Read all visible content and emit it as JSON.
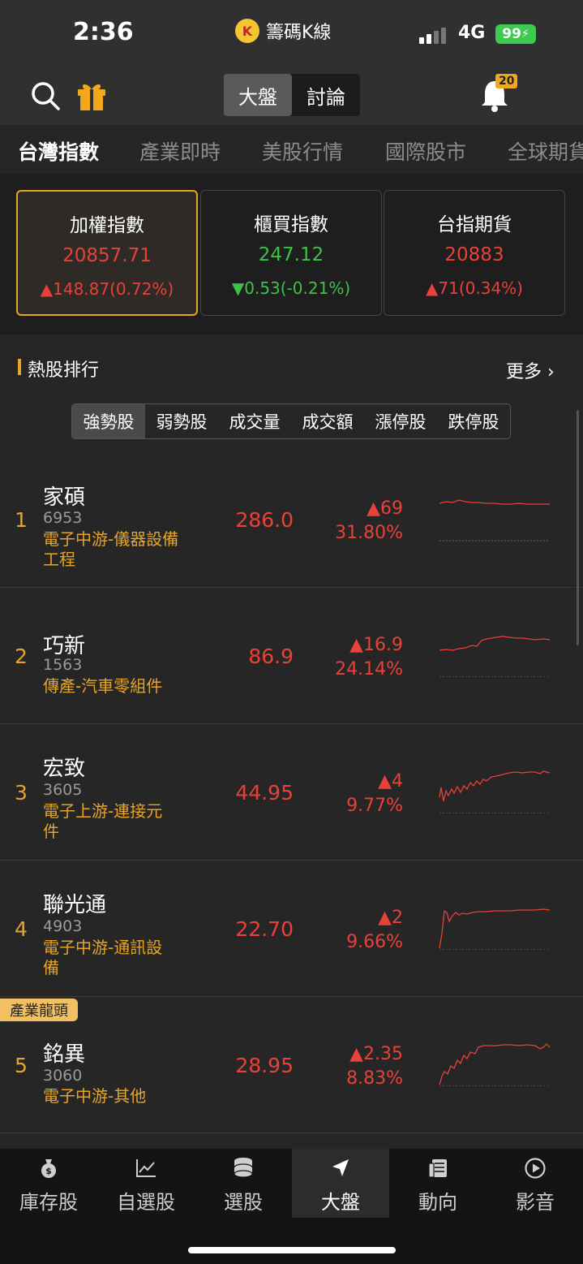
{
  "status_bar": {
    "time": "2:36",
    "carrier": "籌碼K線",
    "carrier_logo": "K",
    "network": "4G",
    "battery": "99"
  },
  "header": {
    "segments": [
      "大盤",
      "討論"
    ],
    "active_segment": "大盤",
    "notification_count": "20",
    "more_label": "更多"
  },
  "tabs": [
    "台灣指數",
    "產業即時",
    "美股行情",
    "國際股市",
    "全球期貨"
  ],
  "index_cards": [
    {
      "name": "加權指數",
      "value": "20857.71",
      "change": "▲148.87(0.72%)",
      "direction": "up"
    },
    {
      "name": "櫃買指數",
      "value": "247.12",
      "change": "▼0.53(-0.21%)",
      "direction": "down"
    },
    {
      "name": "台指期貨",
      "value": "20883",
      "change": "▲71(0.34%)",
      "direction": "up"
    }
  ],
  "hot_stocks": {
    "title": "熱股排行",
    "more": "更多 ›",
    "filters": [
      "強勢股",
      "弱勢股",
      "成交量",
      "成交額",
      "漲停股",
      "跌停股"
    ],
    "active_filter": "強勢股",
    "rows": [
      {
        "rank": "1",
        "name": "家碩",
        "code": "6953",
        "industry": "電子中游-儀器設備工程",
        "price": "286.0",
        "change": "▲69",
        "percent": "31.80%"
      },
      {
        "rank": "2",
        "name": "巧新",
        "code": "1563",
        "industry": "傳產-汽車零組件",
        "price": "86.9",
        "change": "▲16.9",
        "percent": "24.14%"
      },
      {
        "rank": "3",
        "name": "宏致",
        "code": "3605",
        "industry": "電子上游-連接元件",
        "price": "44.95",
        "change": "▲4",
        "percent": "9.77%"
      },
      {
        "rank": "4",
        "name": "聯光通",
        "code": "4903",
        "industry": "電子中游-通訊設備",
        "price": "22.70",
        "change": "▲2",
        "percent": "9.66%"
      },
      {
        "rank": "5",
        "name": "銘異",
        "code": "3060",
        "industry": "電子中游-其他",
        "price": "28.95",
        "change": "▲2.35",
        "percent": "8.83%",
        "tag": "產業龍頭"
      }
    ]
  },
  "bottom_nav": [
    {
      "label": "庫存股",
      "icon": "money-bag-icon"
    },
    {
      "label": "自選股",
      "icon": "trend-chart-icon"
    },
    {
      "label": "選股",
      "icon": "database-icon"
    },
    {
      "label": "大盤",
      "icon": "navigation-arrow-icon"
    },
    {
      "label": "動向",
      "icon": "newspaper-icon"
    },
    {
      "label": "影音",
      "icon": "play-circle-icon"
    }
  ],
  "active_nav": "大盤",
  "colors": {
    "up": "#e8413a",
    "down": "#3fc04a",
    "accent": "#e5a52b",
    "background": "#262626"
  }
}
